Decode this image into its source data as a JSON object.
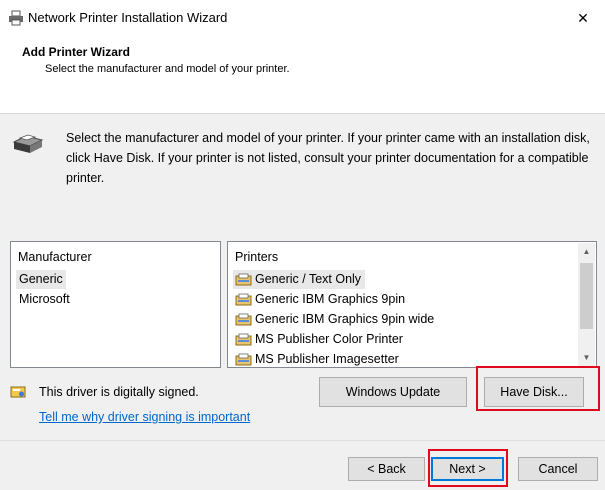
{
  "window": {
    "title": "Network Printer Installation Wizard",
    "close_glyph": "✕"
  },
  "header": {
    "title": "Add Printer Wizard",
    "subtitle": "Select the manufacturer and model of your printer."
  },
  "instruction": "Select the manufacturer and model of your printer. If your printer came with an installation disk, click Have Disk. If your printer is not listed, consult your printer documentation for a compatible printer.",
  "manufacturer_list": {
    "header": "Manufacturer",
    "items": [
      "Generic",
      "Microsoft"
    ],
    "selected": "Generic"
  },
  "printer_list": {
    "header": "Printers",
    "items": [
      "Generic / Text Only",
      "Generic IBM Graphics 9pin",
      "Generic IBM Graphics 9pin wide",
      "MS Publisher Color Printer",
      "MS Publisher Imagesetter"
    ],
    "selected": "Generic / Text Only"
  },
  "buttons": {
    "windows_update": "Windows Update",
    "have_disk": "Have Disk...",
    "back": "< Back",
    "next": "Next >",
    "cancel": "Cancel"
  },
  "driver_status": "This driver is digitally signed.",
  "signing_link": "Tell me why driver signing is important",
  "colors": {
    "highlight": "#e00a1e",
    "link": "#0066cc",
    "default_button_border": "#0078d7"
  }
}
